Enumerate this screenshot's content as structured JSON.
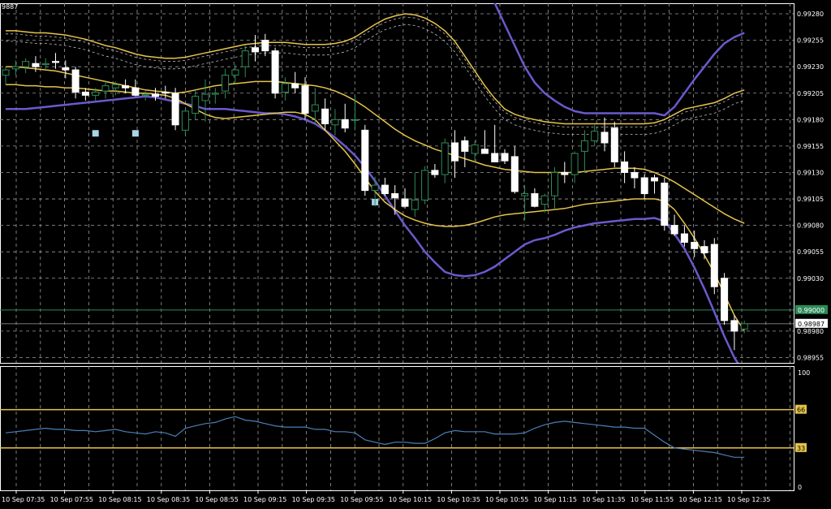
{
  "symbol_corner": "9887",
  "chart_data": [
    {
      "type": "candlestick",
      "title": "",
      "ylim": [
        0.9895,
        0.9929
      ],
      "y_ticks": [
        "0.99280",
        "0.99255",
        "0.99230",
        "0.99205",
        "0.99180",
        "0.99155",
        "0.99130",
        "0.99105",
        "0.99080",
        "0.99055",
        "0.99030",
        "0.98980",
        "0.98955"
      ],
      "x_ticks": [
        "10 Sep 07:35",
        "10 Sep 07:55",
        "10 Sep 08:15",
        "10 Sep 08:35",
        "10 Sep 08:55",
        "10 Sep 09:15",
        "10 Sep 09:35",
        "10 Sep 09:55",
        "10 Sep 10:15",
        "10 Sep 10:35",
        "10 Sep 10:55",
        "10 Sep 11:15",
        "10 Sep 11:35",
        "10 Sep 11:55",
        "10 Sep 12:15",
        "10 Sep 12:35"
      ],
      "horizontal_line": {
        "value": 0.99,
        "label": "0.99000",
        "color": "#2e8b57"
      },
      "current_price": {
        "value": 0.98987,
        "label": "0.98987"
      },
      "colors": {
        "bull": "#2e8b57",
        "bear": "#ffffff",
        "grid": "#9a9a9a",
        "band_outer": "#6a5acd",
        "band_inner": "#e6c34a",
        "envelope": "#bbbbbb",
        "marker": "#a8d4e6"
      },
      "candles": [
        {
          "o": 0.99222,
          "h": 0.9923,
          "l": 0.99213,
          "c": 0.99227
        },
        {
          "o": 0.99228,
          "h": 0.99236,
          "l": 0.99222,
          "c": 0.9923
        },
        {
          "o": 0.9923,
          "h": 0.99238,
          "l": 0.99224,
          "c": 0.99235
        },
        {
          "o": 0.99233,
          "h": 0.9924,
          "l": 0.99225,
          "c": 0.9923
        },
        {
          "o": 0.99232,
          "h": 0.99238,
          "l": 0.99227,
          "c": 0.99233
        },
        {
          "o": 0.99235,
          "h": 0.99243,
          "l": 0.99228,
          "c": 0.99234
        },
        {
          "o": 0.99229,
          "h": 0.99236,
          "l": 0.99219,
          "c": 0.99227
        },
        {
          "o": 0.99227,
          "h": 0.9923,
          "l": 0.992,
          "c": 0.99206
        },
        {
          "o": 0.99206,
          "h": 0.9921,
          "l": 0.99198,
          "c": 0.99203
        },
        {
          "o": 0.99203,
          "h": 0.9921,
          "l": 0.99198,
          "c": 0.99206
        },
        {
          "o": 0.99207,
          "h": 0.99217,
          "l": 0.992,
          "c": 0.99212
        },
        {
          "o": 0.9921,
          "h": 0.99216,
          "l": 0.99203,
          "c": 0.99213
        },
        {
          "o": 0.99212,
          "h": 0.99218,
          "l": 0.99205,
          "c": 0.9921
        },
        {
          "o": 0.9921,
          "h": 0.99218,
          "l": 0.99202,
          "c": 0.99203
        },
        {
          "o": 0.99203,
          "h": 0.99207,
          "l": 0.99198,
          "c": 0.99204
        },
        {
          "o": 0.99204,
          "h": 0.9921,
          "l": 0.99198,
          "c": 0.99202
        },
        {
          "o": 0.99206,
          "h": 0.99212,
          "l": 0.992,
          "c": 0.99205
        },
        {
          "o": 0.99205,
          "h": 0.9921,
          "l": 0.9917,
          "c": 0.99175
        },
        {
          "o": 0.9917,
          "h": 0.9919,
          "l": 0.99165,
          "c": 0.99188
        },
        {
          "o": 0.99186,
          "h": 0.99208,
          "l": 0.9918,
          "c": 0.99202
        },
        {
          "o": 0.99198,
          "h": 0.99218,
          "l": 0.99178,
          "c": 0.99204
        },
        {
          "o": 0.99204,
          "h": 0.9921,
          "l": 0.99195,
          "c": 0.99205
        },
        {
          "o": 0.99207,
          "h": 0.99228,
          "l": 0.992,
          "c": 0.99222
        },
        {
          "o": 0.99222,
          "h": 0.99232,
          "l": 0.99215,
          "c": 0.99227
        },
        {
          "o": 0.9923,
          "h": 0.9925,
          "l": 0.9922,
          "c": 0.99245
        },
        {
          "o": 0.99248,
          "h": 0.9926,
          "l": 0.99235,
          "c": 0.99244
        },
        {
          "o": 0.99255,
          "h": 0.99261,
          "l": 0.9924,
          "c": 0.99245
        },
        {
          "o": 0.99245,
          "h": 0.99248,
          "l": 0.992,
          "c": 0.99205
        },
        {
          "o": 0.99206,
          "h": 0.9922,
          "l": 0.99198,
          "c": 0.99214
        },
        {
          "o": 0.99214,
          "h": 0.99225,
          "l": 0.99205,
          "c": 0.9921
        },
        {
          "o": 0.99212,
          "h": 0.9922,
          "l": 0.9918,
          "c": 0.99186
        },
        {
          "o": 0.99188,
          "h": 0.9921,
          "l": 0.99175,
          "c": 0.99194
        },
        {
          "o": 0.9919,
          "h": 0.992,
          "l": 0.9917,
          "c": 0.99176
        },
        {
          "o": 0.99175,
          "h": 0.9919,
          "l": 0.99165,
          "c": 0.9918
        },
        {
          "o": 0.9918,
          "h": 0.99195,
          "l": 0.99168,
          "c": 0.99172
        },
        {
          "o": 0.9918,
          "h": 0.99202,
          "l": 0.9917,
          "c": 0.9918
        },
        {
          "o": 0.9917,
          "h": 0.99175,
          "l": 0.99108,
          "c": 0.99113
        },
        {
          "o": 0.99113,
          "h": 0.99126,
          "l": 0.99098,
          "c": 0.99118
        },
        {
          "o": 0.99118,
          "h": 0.99125,
          "l": 0.99108,
          "c": 0.9911
        },
        {
          "o": 0.9911,
          "h": 0.99118,
          "l": 0.9909,
          "c": 0.99106
        },
        {
          "o": 0.99105,
          "h": 0.99115,
          "l": 0.99096,
          "c": 0.99098
        },
        {
          "o": 0.99095,
          "h": 0.9913,
          "l": 0.99088,
          "c": 0.99104
        },
        {
          "o": 0.99104,
          "h": 0.99136,
          "l": 0.991,
          "c": 0.99132
        },
        {
          "o": 0.99132,
          "h": 0.99138,
          "l": 0.99125,
          "c": 0.99128
        },
        {
          "o": 0.99128,
          "h": 0.99162,
          "l": 0.9912,
          "c": 0.99158
        },
        {
          "o": 0.99158,
          "h": 0.9917,
          "l": 0.99125,
          "c": 0.99141
        },
        {
          "o": 0.9916,
          "h": 0.99164,
          "l": 0.99135,
          "c": 0.9915
        },
        {
          "o": 0.99148,
          "h": 0.9916,
          "l": 0.9914,
          "c": 0.99156
        },
        {
          "o": 0.99152,
          "h": 0.9917,
          "l": 0.99148,
          "c": 0.99148
        },
        {
          "o": 0.99148,
          "h": 0.99175,
          "l": 0.99145,
          "c": 0.9914
        },
        {
          "o": 0.99148,
          "h": 0.99152,
          "l": 0.99138,
          "c": 0.99141
        },
        {
          "o": 0.99145,
          "h": 0.99155,
          "l": 0.9911,
          "c": 0.99112
        },
        {
          "o": 0.99108,
          "h": 0.99118,
          "l": 0.99085,
          "c": 0.9911
        },
        {
          "o": 0.9911,
          "h": 0.99115,
          "l": 0.99097,
          "c": 0.99098
        },
        {
          "o": 0.991,
          "h": 0.9911,
          "l": 0.99092,
          "c": 0.99108
        },
        {
          "o": 0.99108,
          "h": 0.99135,
          "l": 0.99095,
          "c": 0.9913
        },
        {
          "o": 0.9913,
          "h": 0.9914,
          "l": 0.9912,
          "c": 0.99128
        },
        {
          "o": 0.99128,
          "h": 0.9915,
          "l": 0.9912,
          "c": 0.99148
        },
        {
          "o": 0.9915,
          "h": 0.9917,
          "l": 0.9913,
          "c": 0.9916
        },
        {
          "o": 0.9916,
          "h": 0.99175,
          "l": 0.99155,
          "c": 0.99169
        },
        {
          "o": 0.99168,
          "h": 0.99182,
          "l": 0.9915,
          "c": 0.99158
        },
        {
          "o": 0.99172,
          "h": 0.99178,
          "l": 0.99135,
          "c": 0.9914
        },
        {
          "o": 0.9914,
          "h": 0.9915,
          "l": 0.9912,
          "c": 0.9913
        },
        {
          "o": 0.9913,
          "h": 0.99135,
          "l": 0.99115,
          "c": 0.99125
        },
        {
          "o": 0.99125,
          "h": 0.99128,
          "l": 0.99105,
          "c": 0.9911
        },
        {
          "o": 0.99125,
          "h": 0.99128,
          "l": 0.9911,
          "c": 0.99122
        },
        {
          "o": 0.9912,
          "h": 0.99125,
          "l": 0.99075,
          "c": 0.9908
        },
        {
          "o": 0.9908,
          "h": 0.9909,
          "l": 0.9907,
          "c": 0.99072
        },
        {
          "o": 0.99072,
          "h": 0.9908,
          "l": 0.9906,
          "c": 0.99064
        },
        {
          "o": 0.99064,
          "h": 0.99075,
          "l": 0.9905,
          "c": 0.99058
        },
        {
          "o": 0.9906,
          "h": 0.99066,
          "l": 0.99048,
          "c": 0.99054
        },
        {
          "o": 0.99062,
          "h": 0.99068,
          "l": 0.99015,
          "c": 0.99022
        },
        {
          "o": 0.9903,
          "h": 0.99035,
          "l": 0.98986,
          "c": 0.9899
        },
        {
          "o": 0.9899,
          "h": 0.98995,
          "l": 0.98962,
          "c": 0.9898
        },
        {
          "o": 0.98982,
          "h": 0.9899,
          "l": 0.98978,
          "c": 0.98987
        }
      ],
      "bands": {
        "outer_upper": [
          0.993,
          0.993,
          0.993,
          0.993,
          0.993,
          0.993,
          0.993,
          0.993,
          0.993,
          0.993,
          0.993,
          0.993,
          0.993,
          0.993,
          0.993,
          0.993,
          0.993,
          0.993,
          0.993,
          0.993,
          0.993,
          0.993,
          0.993,
          0.993,
          0.993,
          0.993,
          0.993,
          0.993,
          0.993,
          0.993,
          0.993,
          0.993,
          0.993,
          0.993,
          0.993,
          0.993,
          0.993,
          0.993,
          0.993,
          0.993,
          0.993,
          0.993,
          0.993,
          0.993,
          0.993,
          0.993,
          0.993,
          0.993,
          0.993,
          0.9929,
          0.9927,
          0.9925,
          0.9923,
          0.99215,
          0.99205,
          0.99198,
          0.99192,
          0.99188,
          0.99186,
          0.99186,
          0.99186,
          0.99186,
          0.99186,
          0.99186,
          0.99186,
          0.99186,
          0.99184,
          0.99192,
          0.99205,
          0.99218,
          0.9923,
          0.99242,
          0.99252,
          0.99258,
          0.99262
        ],
        "outer_lower": [
          0.9919,
          0.9919,
          0.9919,
          0.99191,
          0.99192,
          0.99193,
          0.99194,
          0.99195,
          0.99196,
          0.99197,
          0.99198,
          0.99199,
          0.992,
          0.99201,
          0.99202,
          0.99201,
          0.99199,
          0.99197,
          0.99195,
          0.99193,
          0.9919,
          0.9919,
          0.9919,
          0.99189,
          0.99188,
          0.99187,
          0.99186,
          0.99186,
          0.99185,
          0.99183,
          0.9918,
          0.99176,
          0.9917,
          0.99163,
          0.99155,
          0.99146,
          0.99135,
          0.99122,
          0.99108,
          0.99094,
          0.9908,
          0.99068,
          0.99055,
          0.99045,
          0.99036,
          0.99033,
          0.99032,
          0.99033,
          0.99036,
          0.99041,
          0.99048,
          0.99055,
          0.99062,
          0.99066,
          0.99068,
          0.99071,
          0.99075,
          0.99078,
          0.9908,
          0.99082,
          0.99083,
          0.99084,
          0.99085,
          0.99086,
          0.99086,
          0.99087,
          0.99084,
          0.99072,
          0.99058,
          0.9904,
          0.9902,
          0.98998,
          0.98975,
          0.98955,
          0.9894
        ],
        "inner_upper": [
          0.99264,
          0.99264,
          0.99263,
          0.99262,
          0.99262,
          0.99261,
          0.9926,
          0.99258,
          0.99256,
          0.99253,
          0.9925,
          0.99248,
          0.99245,
          0.99242,
          0.9924,
          0.99239,
          0.99238,
          0.99238,
          0.99239,
          0.99241,
          0.99243,
          0.99245,
          0.99247,
          0.99249,
          0.99251,
          0.99252,
          0.99253,
          0.99253,
          0.99253,
          0.99252,
          0.99251,
          0.99251,
          0.99251,
          0.99252,
          0.99254,
          0.99258,
          0.99264,
          0.9927,
          0.99275,
          0.99278,
          0.9928,
          0.99279,
          0.99276,
          0.99271,
          0.99264,
          0.99254,
          0.9924,
          0.99226,
          0.99212,
          0.992,
          0.9919,
          0.99185,
          0.99182,
          0.9918,
          0.99178,
          0.99177,
          0.99176,
          0.99176,
          0.99176,
          0.99176,
          0.99176,
          0.99176,
          0.99176,
          0.99176,
          0.99176,
          0.99177,
          0.9918,
          0.99185,
          0.9919,
          0.99192,
          0.99194,
          0.99196,
          0.992,
          0.99205,
          0.99208
        ],
        "inner_lower": [
          0.99213,
          0.99213,
          0.99212,
          0.99212,
          0.99211,
          0.99211,
          0.9921,
          0.9921,
          0.99209,
          0.99208,
          0.99207,
          0.99207,
          0.99206,
          0.99205,
          0.99205,
          0.99204,
          0.99203,
          0.992,
          0.99195,
          0.9919,
          0.99185,
          0.99182,
          0.99181,
          0.99182,
          0.99183,
          0.99184,
          0.99185,
          0.99186,
          0.99187,
          0.99187,
          0.99185,
          0.9918,
          0.9917,
          0.9916,
          0.9915,
          0.99138,
          0.99125,
          0.99112,
          0.99102,
          0.99095,
          0.99089,
          0.99085,
          0.99082,
          0.9908,
          0.99079,
          0.99079,
          0.9908,
          0.99082,
          0.99085,
          0.99088,
          0.9909,
          0.99091,
          0.99092,
          0.99093,
          0.99094,
          0.99095,
          0.99096,
          0.99098,
          0.991,
          0.99101,
          0.99102,
          0.99103,
          0.99104,
          0.99105,
          0.99105,
          0.99105,
          0.99103,
          0.99095,
          0.99082,
          0.99068,
          0.99052,
          0.99035,
          0.99015,
          0.98995,
          0.9898
        ],
        "middle": [
          0.9923,
          0.9923,
          0.99229,
          0.99228,
          0.99227,
          0.99226,
          0.99224,
          0.99222,
          0.9922,
          0.99218,
          0.99216,
          0.99214,
          0.99212,
          0.9921,
          0.99208,
          0.99207,
          0.99206,
          0.99205,
          0.99206,
          0.99208,
          0.9921,
          0.99212,
          0.99213,
          0.99214,
          0.99215,
          0.99216,
          0.99216,
          0.99216,
          0.99215,
          0.99214,
          0.99213,
          0.99212,
          0.9921,
          0.99207,
          0.99203,
          0.99198,
          0.99192,
          0.99185,
          0.99178,
          0.99171,
          0.99165,
          0.9916,
          0.99156,
          0.99152,
          0.99149,
          0.99146,
          0.99143,
          0.9914,
          0.99137,
          0.99135,
          0.99133,
          0.99132,
          0.99131,
          0.9913,
          0.9913,
          0.9913,
          0.9913,
          0.9913,
          0.99131,
          0.99132,
          0.99133,
          0.99134,
          0.99134,
          0.99134,
          0.99133,
          0.9913,
          0.99126,
          0.99121,
          0.99115,
          0.99109,
          0.99103,
          0.99097,
          0.99091,
          0.99086,
          0.99082
        ]
      },
      "markers": [
        {
          "i": 9,
          "v": 0.99167
        },
        {
          "i": 13,
          "v": 0.99167
        },
        {
          "i": 37,
          "v": 0.99102
        }
      ]
    },
    {
      "type": "line",
      "title": "",
      "ylim": [
        0,
        100
      ],
      "y_ticks": [
        "100",
        "66",
        "33",
        "0"
      ],
      "levels": [
        66,
        33
      ],
      "colors": {
        "line": "#4a7fb8",
        "level": "#e6c34a"
      },
      "values": [
        46,
        47,
        48,
        49,
        50,
        49,
        49,
        48,
        48,
        47,
        48,
        49,
        47,
        46,
        45,
        47,
        46,
        43,
        50,
        52,
        54,
        55,
        58,
        60,
        57,
        56,
        54,
        52,
        51,
        51,
        51,
        49,
        49,
        47,
        47,
        46,
        40,
        38,
        36,
        38,
        38,
        37,
        37,
        41,
        46,
        48,
        47,
        47,
        47,
        45,
        45,
        45,
        46,
        50,
        53,
        55,
        56,
        55,
        54,
        53,
        52,
        51,
        51,
        50,
        50,
        44,
        38,
        33,
        32,
        31,
        30,
        29,
        27,
        25,
        25
      ]
    }
  ]
}
